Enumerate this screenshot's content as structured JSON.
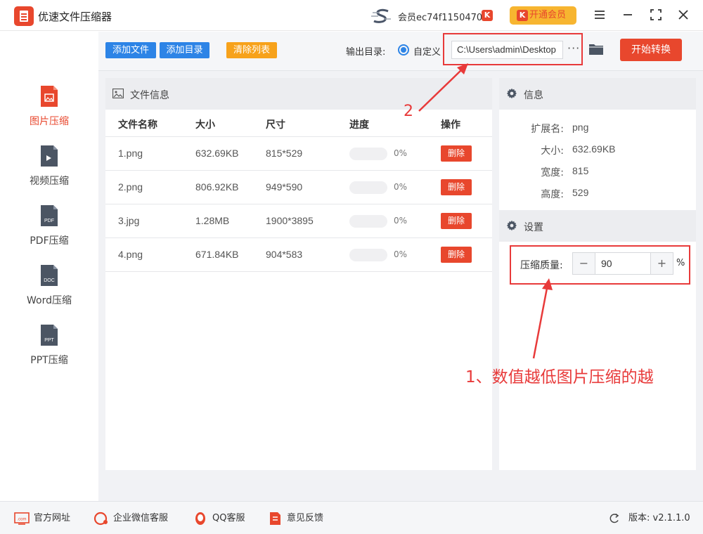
{
  "app": {
    "title": "优速文件压缩器"
  },
  "titlebar": {
    "member_id": "会员ec74f1150470",
    "member_badge": "K",
    "vip_label": "开通会员"
  },
  "sidebar": {
    "items": [
      {
        "label": "图片压缩",
        "badge": "",
        "color": "#e8472d"
      },
      {
        "label": "视频压缩",
        "badge": "▶",
        "color": "#4b5563"
      },
      {
        "label": "PDF压缩",
        "badge": "PDF",
        "color": "#4b5563"
      },
      {
        "label": "Word压缩",
        "badge": "DOC",
        "color": "#4b5563"
      },
      {
        "label": "PPT压缩",
        "badge": "PPT",
        "color": "#4b5563"
      }
    ]
  },
  "toolbar": {
    "add_file": "添加文件",
    "add_dir": "添加目录",
    "clear_list": "清除列表",
    "output_label": "输出目录:",
    "custom_label": "自定义",
    "output_path": "C:\\Users\\admin\\Desktop",
    "more": "···",
    "start": "开始转换"
  },
  "file_panel": {
    "title": "文件信息",
    "columns": [
      "文件名称",
      "大小",
      "尺寸",
      "进度",
      "操作"
    ],
    "rows": [
      {
        "name": "1.png",
        "size": "632.69KB",
        "dims": "815*529",
        "progress": 0,
        "progress_label": "0%",
        "action": "删除"
      },
      {
        "name": "2.png",
        "size": "806.92KB",
        "dims": "949*590",
        "progress": 0,
        "progress_label": "0%",
        "action": "删除"
      },
      {
        "name": "3.jpg",
        "size": "1.28MB",
        "dims": "1900*3895",
        "progress": 0,
        "progress_label": "0%",
        "action": "删除"
      },
      {
        "name": "4.png",
        "size": "671.84KB",
        "dims": "904*583",
        "progress": 0,
        "progress_label": "0%",
        "action": "删除"
      }
    ]
  },
  "info_panel": {
    "title": "信息",
    "fields": [
      {
        "key": "扩展名:",
        "value": "png"
      },
      {
        "key": "大小:",
        "value": "632.69KB"
      },
      {
        "key": "宽度:",
        "value": "815"
      },
      {
        "key": "高度:",
        "value": "529"
      }
    ]
  },
  "settings_panel": {
    "title": "设置",
    "quality_label": "压缩质量:",
    "quality_value": "90",
    "minus": "−",
    "plus": "+",
    "unit": "%"
  },
  "annotations": {
    "note1": "1、数值越低图片压缩的越",
    "note2": "2"
  },
  "footer": {
    "website": "官方网址",
    "wechat": "企业微信客服",
    "qq": "QQ客服",
    "feedback": "意见反馈",
    "version": "版本: v2.1.1.0"
  },
  "colors": {
    "accent": "#e8472d",
    "blue": "#2d84e6",
    "orange": "#f7a21b",
    "annotation": "#e83a3a"
  }
}
